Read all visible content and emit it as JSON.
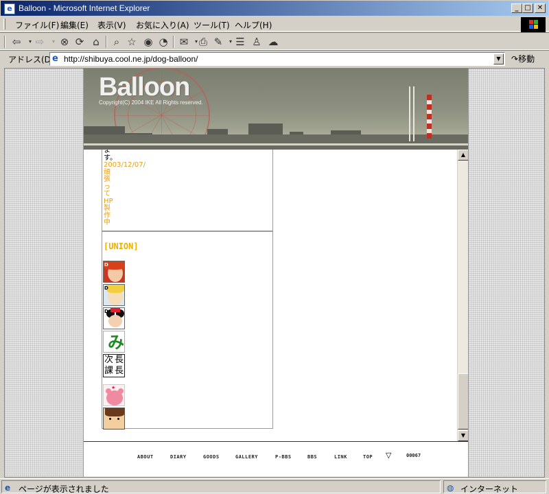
{
  "window": {
    "title": "Balloon - Microsoft Internet Explorer",
    "minimize": "_",
    "maximize": "□",
    "close": "✕"
  },
  "menu": {
    "items": [
      "ファイル(F)",
      "編集(E)",
      "表示(V)",
      "お気に入り(A)",
      "ツール(T)",
      "ヘルプ(H)"
    ]
  },
  "toolbar": {
    "icons": [
      "back-icon",
      "forward-icon",
      "stop-icon",
      "refresh-icon",
      "home-icon",
      "search-icon",
      "favorites-icon",
      "history-icon",
      "mail-icon",
      "print-icon",
      "edit-icon",
      "discuss-icon",
      "messenger-icon"
    ]
  },
  "address": {
    "label": "アドレス(D)",
    "url": "http://shibuya.cool.ne.jp/dog-balloon/",
    "go_label": "移動"
  },
  "site": {
    "logo": "Balloon",
    "copyright": "Copyright(C) 2004 IKE All Rights reserved.",
    "box1_lines_black": [
      "ま",
      "す。"
    ],
    "box1_date": "2003/12/07/",
    "box1_lines_orange": [
      "頑",
      "張",
      "っ",
      "て",
      "HP",
      "製",
      "作",
      "中"
    ],
    "union_label": "[UNION]",
    "avatars": [
      "union-banner-1",
      "union-banner-2",
      "union-banner-3",
      "union-banner-4",
      "union-banner-5",
      "union-banner-6",
      "union-banner-7"
    ],
    "banner5_text": [
      "次",
      "長",
      "課",
      "長"
    ]
  },
  "footer": {
    "nav": [
      "ABOUT",
      "DIARY",
      "GOODS",
      "GALLERY",
      "P-BBS",
      "BBS",
      "LINK",
      "TOP"
    ],
    "counter": "00067"
  },
  "status": {
    "text": "ページが表示されました",
    "zone": "インターネット"
  }
}
